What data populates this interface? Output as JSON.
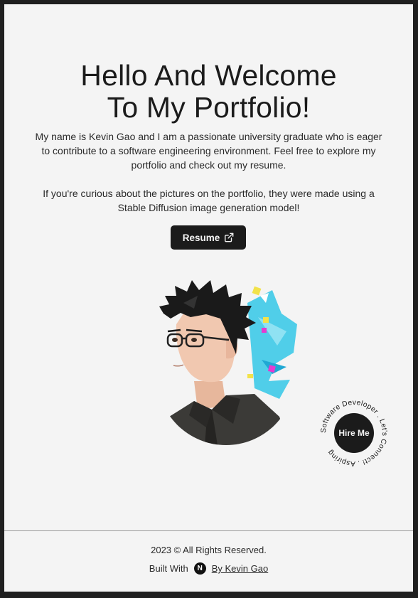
{
  "hero": {
    "title_line1": "Hello And Welcome",
    "title_line2": "To My Portfolio!"
  },
  "intro": {
    "paragraph1": "My name is Kevin Gao and I am a passionate university graduate who is eager to contribute to a software engineering environment. Feel free to explore my portfolio and check out my resume.",
    "paragraph2": "If you're curious about the pictures on the portfolio, they were made using a Stable Diffusion image generation model!"
  },
  "resume_button": {
    "label": "Resume",
    "icon": "external-link-icon"
  },
  "portrait": {
    "icon": "portrait-illustration"
  },
  "hire_badge": {
    "label": "Hire Me",
    "ring_text": "Software Developer . Let's Connect! . Aspiring "
  },
  "footer": {
    "copyright": "2023 © All Rights Reserved.",
    "built_with": "Built With",
    "framework_logo": "N",
    "author_link": "By Kevin Gao"
  },
  "colors": {
    "background": "#f4f4f4",
    "frame": "#1f1f1f",
    "dark": "#1b1b1b",
    "accent_cyan": "#33c7e6",
    "accent_magenta": "#e43bd0",
    "accent_yellow": "#f2e24a"
  }
}
